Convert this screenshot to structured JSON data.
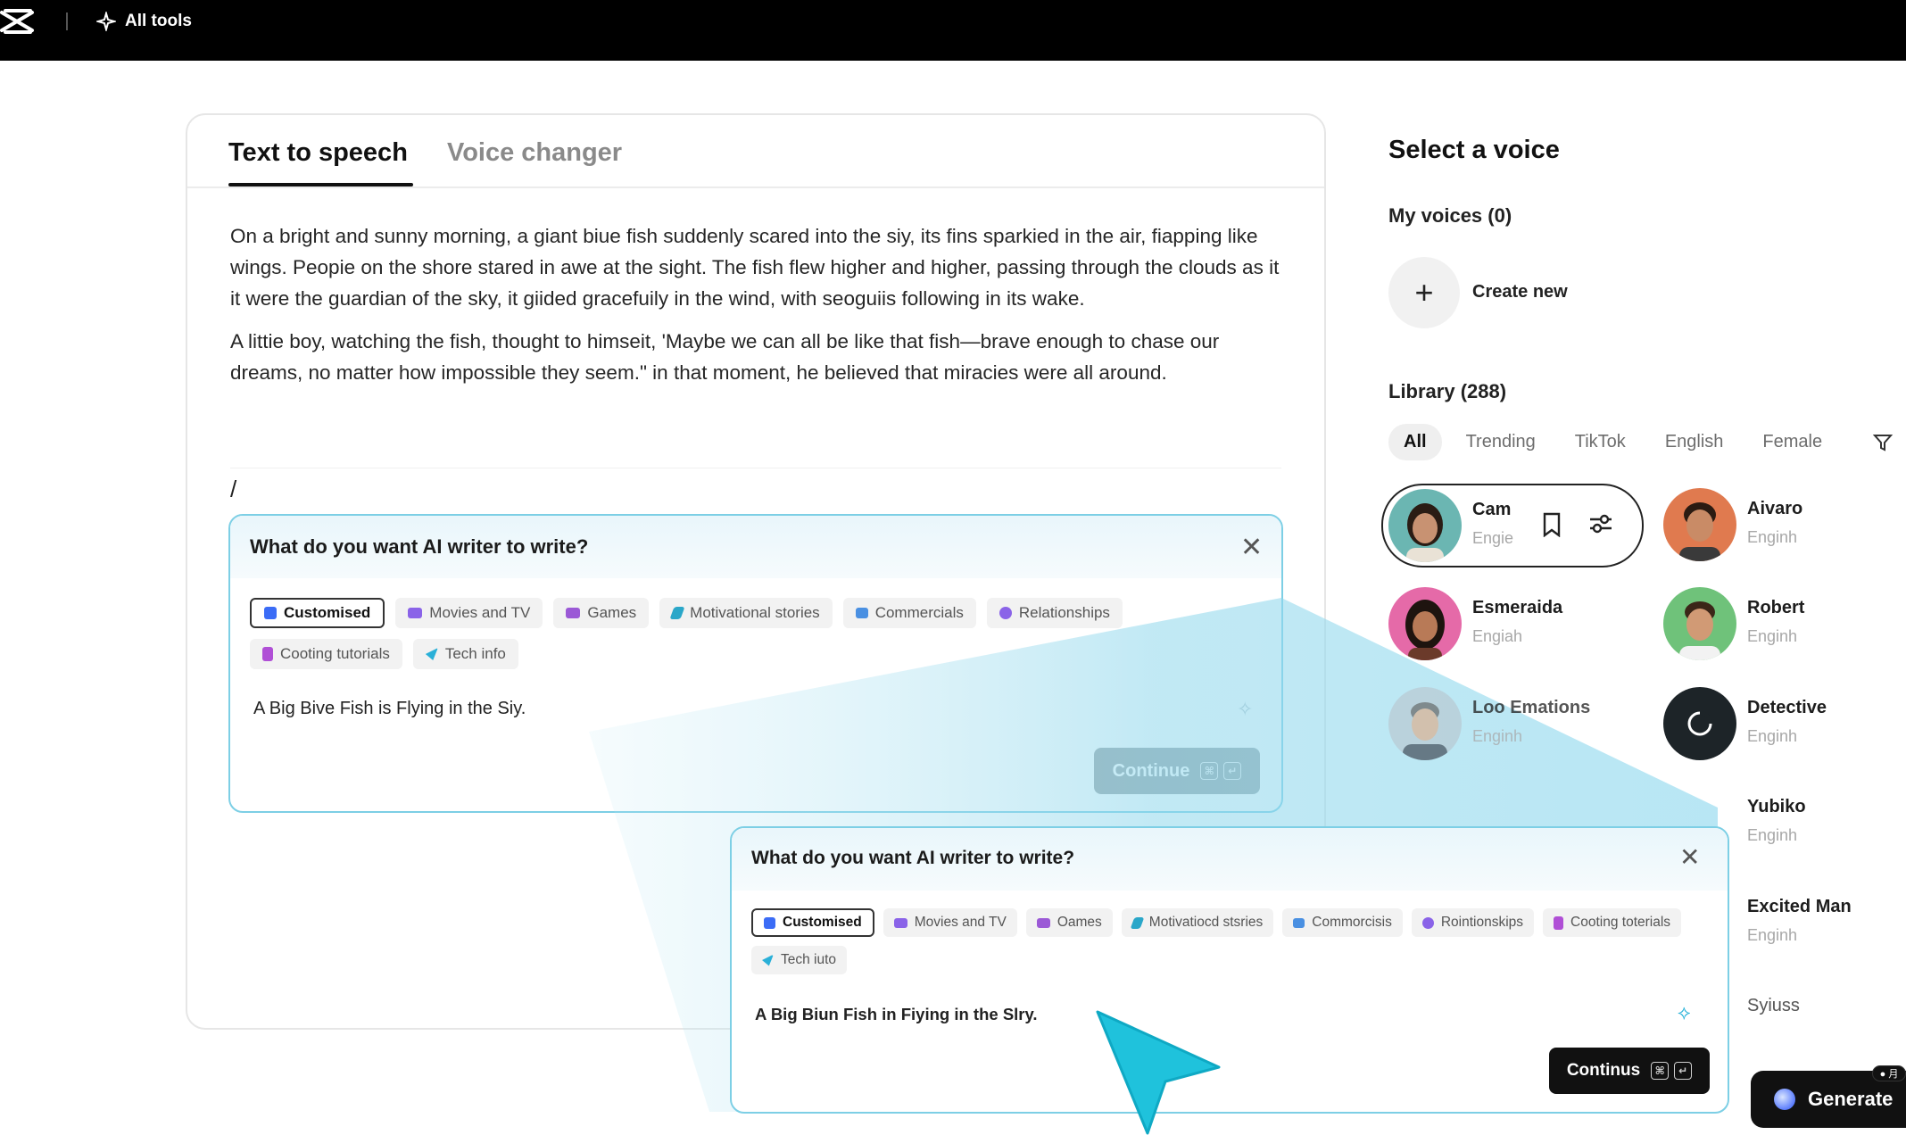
{
  "topbar": {
    "tools_label": "All tools"
  },
  "tabs": [
    {
      "label": "Text to speech",
      "active": true
    },
    {
      "label": "Voice changer",
      "active": false
    }
  ],
  "story": {
    "paragraph1": "On a bright and sunny morning, a giant biue fish suddenly scared into the siy, its fins sparkied in the air, fiapping like wings. Peopie on the shore stared in awe at the sight. The fish flew higher and higher, passing through the clouds as it it were the guardian of the sky, it giided gracefuily in the wind, with seoguiis following in its wake.",
    "paragraph2": "A littie boy, watching the fish, thought to himseit, 'Maybe we can all be like that fish—brave enough to chase our dreams, no matter how impossible they seem.\" in that moment, he believed that miracies were all around.",
    "cursor": "/"
  },
  "ai_panel": {
    "title": "What do you want AI writer to write?",
    "chips": [
      {
        "label": "Customised",
        "selected": true,
        "icon": "doc-icon",
        "color": "#3b6cf6"
      },
      {
        "label": "Movies and TV",
        "icon": "film-icon",
        "color": "#8a63e8"
      },
      {
        "label": "Games",
        "icon": "gamepad-icon",
        "color": "#9b59d6"
      },
      {
        "label": "Motivational stories",
        "icon": "pen-icon",
        "color": "#2aa7c9"
      },
      {
        "label": "Commercials",
        "icon": "chat-icon",
        "color": "#4a90e2"
      },
      {
        "label": "Relationships",
        "icon": "people-icon",
        "color": "#8a63e8"
      },
      {
        "label": "Cooting tutorials",
        "icon": "chef-icon",
        "color": "#b04fd6"
      },
      {
        "label": "Tech info",
        "icon": "send-icon",
        "color": "#2ab0d8"
      }
    ],
    "prompt": "A Big Bive Fish is Flying in the Siy.",
    "continue_label": "Continue",
    "kbd1": "⌘",
    "kbd2": "↵"
  },
  "ai_panel_zoom": {
    "title": "What do you want AI writer to write?",
    "chips": [
      {
        "label": "Customised",
        "selected": true
      },
      {
        "label": "Movies and TV"
      },
      {
        "label": "Oames"
      },
      {
        "label": "Motivatiocd stsries"
      },
      {
        "label": "Commorcisis"
      },
      {
        "label": "Rointionskips"
      },
      {
        "label": "Cooting toterials"
      },
      {
        "label": "Tech iuto"
      }
    ],
    "prompt": "A Big Biun Fish in Fiying in the Slry.",
    "continue_label": "Continus",
    "kbd1": "⌘",
    "kbd2": "↵"
  },
  "right_panel": {
    "title": "Select a voice",
    "my_voices": "My voices (0)",
    "create_new": "Create new",
    "library": "Library (288)",
    "filters": [
      "All",
      "Trending",
      "TikTok",
      "English",
      "Female"
    ],
    "voices": [
      {
        "name": "Cam",
        "lang": "Engie",
        "skin": "#c89272",
        "hair": "#2a1c14",
        "bg": "#6bb6b2"
      },
      {
        "name": "Aivaro",
        "lang": "Enginh",
        "skin": "#c98b66",
        "hair": "#2b1b12",
        "bg": "#e07a4f"
      },
      {
        "name": "Esmeraida",
        "lang": "Engiah",
        "skin": "#b87a57",
        "hair": "#1e140f",
        "bg": "#e56aa8"
      },
      {
        "name": "Robert",
        "lang": "Enginh",
        "skin": "#d19a75",
        "hair": "#3b2618",
        "bg": "#6fc27a"
      },
      {
        "name": "Loo Emations",
        "lang": "Enginh",
        "skin": "#d9b396",
        "hair": "#6b6b6b",
        "bg": "#b9cbd4"
      },
      {
        "name": "Detective",
        "lang": "Enginh",
        "skin": "#8a8a8a",
        "hair": "#111111",
        "bg": "#1d2428"
      },
      {
        "name": "Yubiko",
        "lang": "Enginh"
      },
      {
        "name": "Excited Man",
        "lang": "Enginh"
      },
      {
        "name": "Syiuss",
        "lang": ""
      }
    ]
  },
  "generate_label": "Generate",
  "generate_badge": "● 月"
}
